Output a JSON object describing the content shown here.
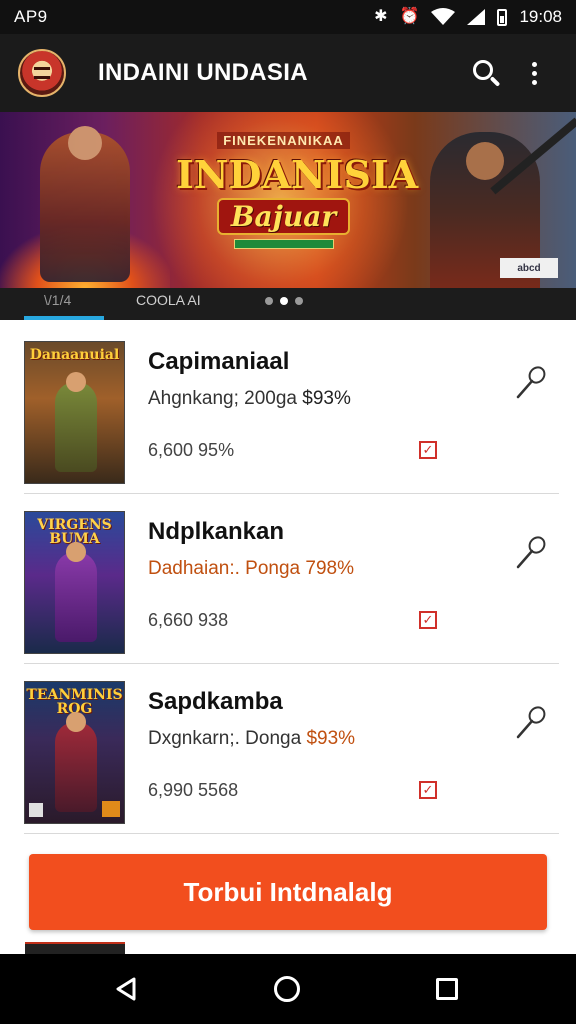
{
  "status_bar": {
    "carrier": "AP9",
    "time": "19:08",
    "icons": [
      "bluetooth-icon",
      "alarm-icon",
      "wifi-icon",
      "signal-icon",
      "battery-icon"
    ]
  },
  "app_bar": {
    "title": "INDAINI UNDASIA",
    "icons": [
      "app-logo-icon",
      "search-icon",
      "more-vert-icon"
    ]
  },
  "banner": {
    "subtitle": "FINEKENANIKAA",
    "title": "INDANISIA",
    "badge": "Bajuar",
    "tag": "abcd"
  },
  "tabs": {
    "items": [
      "\\/1/4",
      "COOLA AI"
    ],
    "pager_dots": 3,
    "active_dot": 2
  },
  "games": [
    {
      "title": "Capimaniaal",
      "thumb_title": "Danaanuial",
      "sub_prefix": "Ahgnkang; 200ga",
      "sub_pct": "$93%",
      "meta": "6,600 95%"
    },
    {
      "title": "Ndplkankan",
      "thumb_title": "VIRGENS BUMA",
      "sub_prefix": "Dadhaian:. Ponga",
      "sub_pct": "798%",
      "meta": "6,660 938"
    },
    {
      "title": "Sapdkamba",
      "thumb_title": "TEANMINIS ROG",
      "sub_prefix": "Dxgnkarn;. Donga",
      "sub_pct": "$93%",
      "meta": "6,990 5568"
    }
  ],
  "cta": {
    "label": "Torbui Intdnalalg"
  },
  "colors": {
    "accent": "#f24e1e",
    "app_bar": "#1b1b1b",
    "tab_indicator": "#28a8e0",
    "price_orange": "#c05010",
    "check_red": "#d0302a"
  }
}
